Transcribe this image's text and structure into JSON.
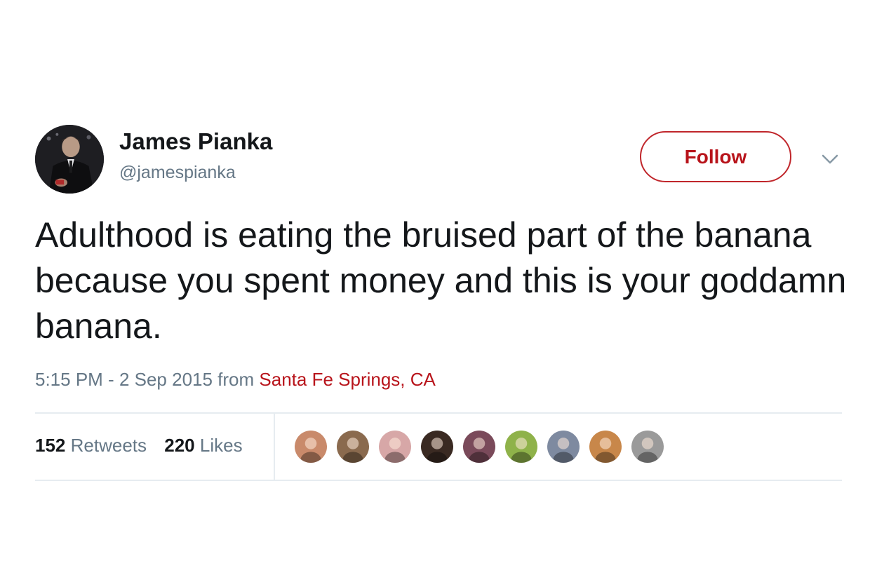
{
  "author": {
    "display_name": "James Pianka",
    "handle": "@jamespianka",
    "avatar_icon": "user-avatar"
  },
  "follow_button": {
    "label": "Follow",
    "color": "#b8141b"
  },
  "menu": {
    "icon": "chevron-down-icon"
  },
  "tweet": {
    "text": "Adulthood is eating the bruised part of the banana because you spent money and this is your goddamn banana."
  },
  "meta": {
    "time": "5:15 PM",
    "separator": " - ",
    "date": "2 Sep 2015",
    "from_label": " from ",
    "location": "Santa Fe Springs, CA"
  },
  "stats": {
    "retweets_count": "152",
    "retweets_label": "Retweets",
    "likes_count": "220",
    "likes_label": "Likes"
  },
  "likers": [
    {
      "name": "liker-avatar-1",
      "color": "#c98a6b"
    },
    {
      "name": "liker-avatar-2",
      "color": "#8a6a4e"
    },
    {
      "name": "liker-avatar-3",
      "color": "#d7a7a7"
    },
    {
      "name": "liker-avatar-4",
      "color": "#3a2a22"
    },
    {
      "name": "liker-avatar-5",
      "color": "#7a4a5a"
    },
    {
      "name": "liker-avatar-6",
      "color": "#8fb24a"
    },
    {
      "name": "liker-avatar-7",
      "color": "#7e8aa0"
    },
    {
      "name": "liker-avatar-8",
      "color": "#c8874a"
    },
    {
      "name": "liker-avatar-9",
      "color": "#9a9a9a"
    }
  ],
  "colors": {
    "accent": "#b8141b",
    "secondary_text": "#657786",
    "primary_text": "#14171a",
    "divider": "#e6ecf0"
  }
}
